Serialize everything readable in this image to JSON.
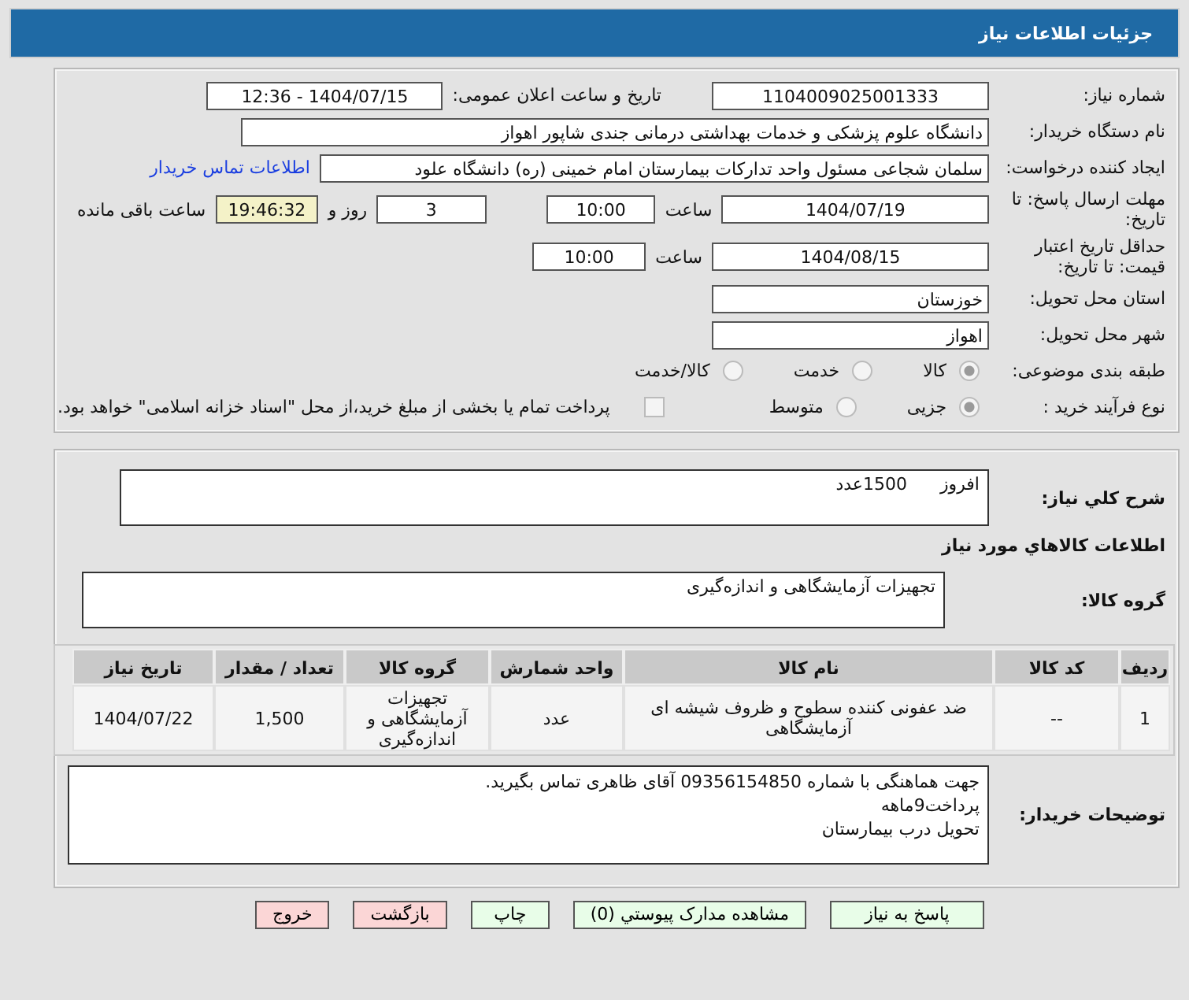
{
  "header": {
    "title": "جزئیات اطلاعات نیاز"
  },
  "info": {
    "need_number_label": "شماره نیاز:",
    "need_number": "1104009025001333",
    "announce_label": "تاریخ و ساعت اعلان عمومی:",
    "announce": "1404/07/15 - 12:36",
    "buyer_label": "نام دستگاه خریدار:",
    "buyer": "دانشگاه علوم پزشکی و خدمات بهداشتی درمانی جندی شاپور اهواز",
    "creator_label": "ایجاد کننده درخواست:",
    "creator": "سلمان شجاعی مسئول واحد تدارکات بیمارستان امام خمینی (ره) دانشگاه علود",
    "contact_link": "اطلاعات تماس خریدار",
    "deadline_label": "مهلت ارسال پاسخ: تا تاریخ:",
    "deadline_date": "1404/07/19",
    "hour_label": "ساعت",
    "deadline_time": "10:00",
    "days": "3",
    "days_label": "روز و",
    "remaining": "19:46:32",
    "remaining_label": "ساعت باقی مانده",
    "validity_label": "حداقل تاریخ اعتبار قیمت: تا تاریخ:",
    "validity_date": "1404/08/15",
    "validity_hour_label": "ساعت",
    "validity_time": "10:00",
    "province_label": "استان محل تحویل:",
    "province": "خوزستان",
    "city_label": "شهر محل تحویل:",
    "city": "اهواز",
    "category_label": "طبقه بندی موضوعی:",
    "categories": [
      {
        "label": "کالا",
        "selected": true
      },
      {
        "label": "خدمت",
        "selected": false
      },
      {
        "label": "کالا/خدمت",
        "selected": false
      }
    ],
    "process_label": "نوع فرآیند خرید :",
    "processes": [
      {
        "label": "جزیی",
        "selected": true
      },
      {
        "label": "متوسط",
        "selected": false
      }
    ],
    "payment": {
      "label": "پرداخت تمام یا بخشی از مبلغ خرید،از محل \"اسناد خزانه اسلامی\" خواهد بود.",
      "checked": false
    }
  },
  "details": {
    "summary_label": "شرح کلي نياز:",
    "summary": "افروز      1500عدد",
    "goods_heading": "اطلاعات کالاهاي مورد نياز",
    "group_label": "گروه کالا:",
    "group": "تجهیزات آزمایشگاهی و اندازه‌گیری",
    "table": {
      "columns": [
        "ردیف",
        "کد کالا",
        "نام کالا",
        "واحد شمارش",
        "گروه کالا",
        "تعداد / مقدار",
        "تاریخ نیاز"
      ],
      "rows": [
        [
          "1",
          "--",
          "ضد عفونی کننده سطوح و ظروف شیشه ای آزمایشگاهی",
          "عدد",
          "تجهیزات آزمایشگاهی و اندازه‌گیری",
          "1,500",
          "1404/07/22"
        ]
      ]
    },
    "notes_label": "توضیحات خریدار:",
    "notes": [
      "جهت هماهنگی با شماره 09356154850 آقای ظاهری تماس بگیرید.",
      "پرداخت9ماهه",
      "تحویل درب بیمارستان"
    ]
  },
  "buttons": [
    {
      "label": "پاسخ به نیاز",
      "kind": "action"
    },
    {
      "label": "مشاهده مدارک پیوستي (0)",
      "kind": "action"
    },
    {
      "label": "چاپ",
      "kind": "action"
    },
    {
      "label": "بازگشت",
      "kind": "exit"
    },
    {
      "label": "خروج",
      "kind": "exit"
    }
  ]
}
